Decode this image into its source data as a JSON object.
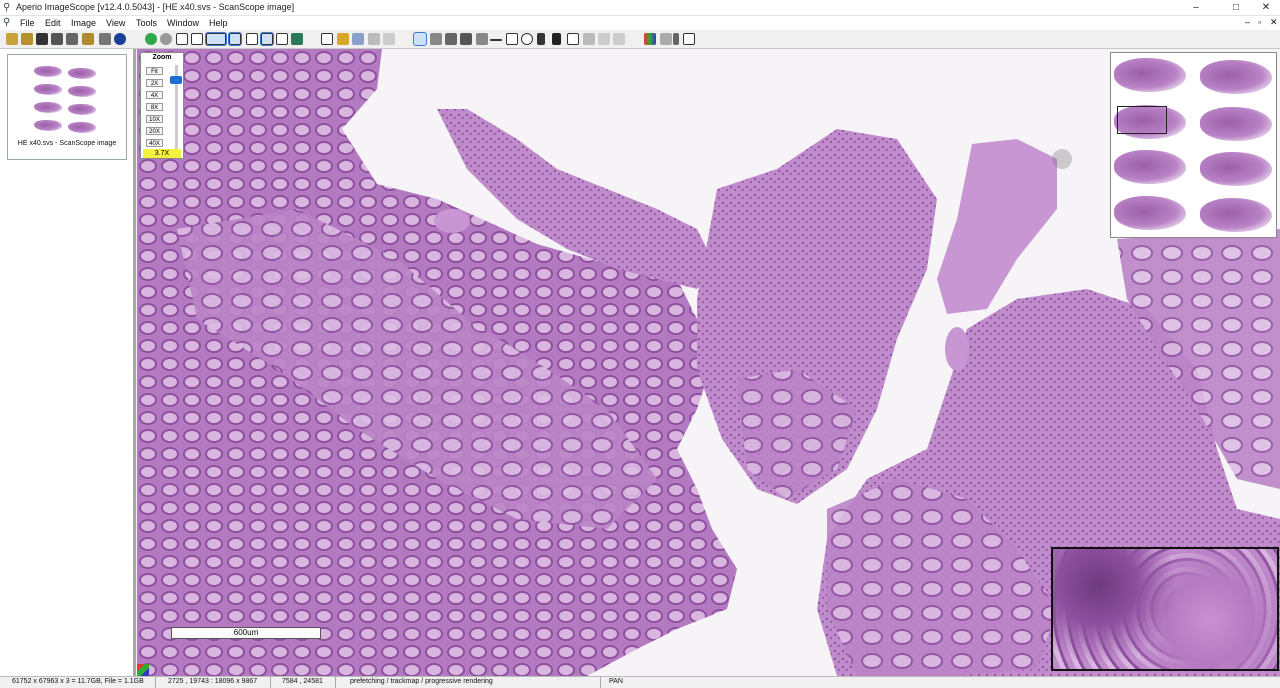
{
  "window": {
    "title": "Aperio ImageScope [v12.4.0.5043] - [HE x40.svs - ScanScope image]",
    "minimize": "–",
    "maximize": "□",
    "close": "✕"
  },
  "menu": {
    "items": [
      "File",
      "Edit",
      "Image",
      "View",
      "Tools",
      "Window",
      "Help"
    ],
    "mdi_controls": [
      "–",
      "▫",
      "✕"
    ]
  },
  "toolbar": {
    "icons": [
      "open-folder",
      "open-folder-2",
      "camera",
      "scanner",
      "print",
      "info-folder",
      "annotations",
      "info",
      "go-forward",
      "stop",
      "slide-layout",
      "layout-2",
      "select-region",
      "view-full",
      "thumbnail",
      "magnifier",
      "overview",
      "edit",
      "tag",
      "compare",
      "back",
      "refresh",
      "pan-hand",
      "magic",
      "tag-2",
      "pen",
      "pin",
      "ruler",
      "rectangle",
      "ellipse",
      "arrow",
      "grid",
      "text",
      "ungroup",
      "copy",
      "paste",
      "color",
      "levels",
      "dropdown",
      "help"
    ]
  },
  "thumbnail": {
    "caption": "HE x40.svs - ScanScope image"
  },
  "zoom": {
    "title": "Zoom",
    "levels": [
      "Fit",
      "2X",
      "4X",
      "8X",
      "10X",
      "20X",
      "40X"
    ],
    "current": "3.7X",
    "slider_fraction": 0.18
  },
  "scale_bar": {
    "label": "600um"
  },
  "status": {
    "image_info": "61752 x 67963 x 3 = 11.7GB, File = 1.1GB",
    "region": "2725 , 19743 : 18096 x 9867",
    "cursor": "7584 , 24581",
    "render_state": "prefetching / trackmap / progressive rendering",
    "mode": "PAN"
  },
  "colors": {
    "tissue_dark": "#8d4f9e",
    "tissue_mid": "#b47ac1",
    "tissue_light": "#d9b6e0",
    "background": "#f7f4f7",
    "zoom_highlight": "#f4f040",
    "accent": "#1d6fd1"
  }
}
